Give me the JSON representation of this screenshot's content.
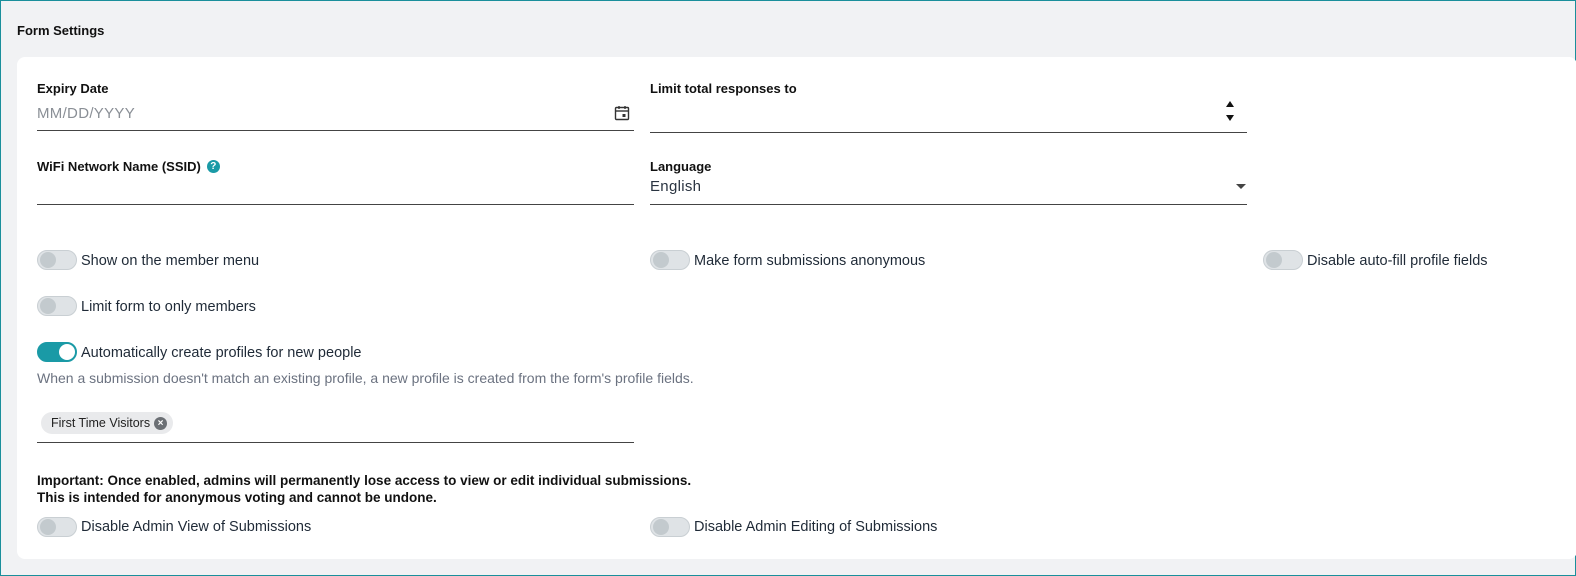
{
  "section_title": "Form Settings",
  "expiry": {
    "label": "Expiry Date",
    "placeholder": "MM/DD/YYYY"
  },
  "limit": {
    "label": "Limit total responses to",
    "value": ""
  },
  "ssid": {
    "label": "WiFi Network Name (SSID)",
    "help": "?"
  },
  "language": {
    "label": "Language",
    "value": "English"
  },
  "toggles": {
    "member_menu": {
      "label": "Show on the member menu",
      "on": false
    },
    "anonymous": {
      "label": "Make form submissions anonymous",
      "on": false
    },
    "autofill": {
      "label": "Disable auto-fill profile fields",
      "on": false
    },
    "members_only": {
      "label": "Limit form to only members",
      "on": false
    },
    "auto_profiles": {
      "label": "Automatically create profiles for new people",
      "on": true
    },
    "admin_view": {
      "label": "Disable Admin View of Submissions",
      "on": false
    },
    "admin_edit": {
      "label": "Disable Admin Editing of Submissions",
      "on": false
    }
  },
  "auto_profiles_desc": "When a submission doesn't match an existing profile, a new profile is created from the form's profile fields.",
  "tags": [
    "First Time Visitors"
  ],
  "warning": {
    "line1": "Important: Once enabled, admins will permanently lose access to view or edit individual submissions.",
    "line2": "This is intended for anonymous voting and cannot be undone."
  },
  "icons": {
    "calendar": "calendar-icon",
    "help": "help-icon",
    "spinner": "spinner-arrows-icon",
    "dropdown": "chevron-down-icon",
    "chip_remove": "close-circle-icon"
  },
  "colors": {
    "accent": "#1a9aa6"
  }
}
